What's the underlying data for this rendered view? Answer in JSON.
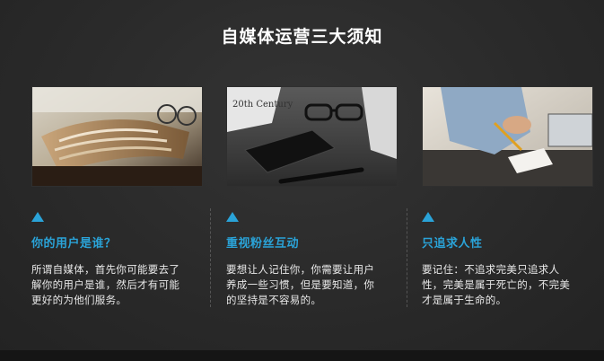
{
  "slide": {
    "title": "自媒体运营三大须知",
    "cards": [
      {
        "heading": "你的用户是谁？",
        "body": "所谓自媒体，首先你可能要去了解你的用户是谁，然后才有可能更好的为他们服务。",
        "photo_text": ""
      },
      {
        "heading": "重视粉丝互动",
        "body": "要想让人记住你，你需要让用户养成一些习惯，但是要知道，你的坚持是不容易的。",
        "photo_text": "20th Century"
      },
      {
        "heading": "只追求人性",
        "body": "要记住：不追求完美只追求人性，完美是属于死亡的，不完美才是属于生命的。",
        "photo_text": ""
      }
    ]
  },
  "colors": {
    "accent": "#2aa3d8",
    "background": "#2b2b2b",
    "title": "#ffffff",
    "body": "#e8e8e8"
  },
  "icons": [
    "triangle-marker-icon"
  ]
}
